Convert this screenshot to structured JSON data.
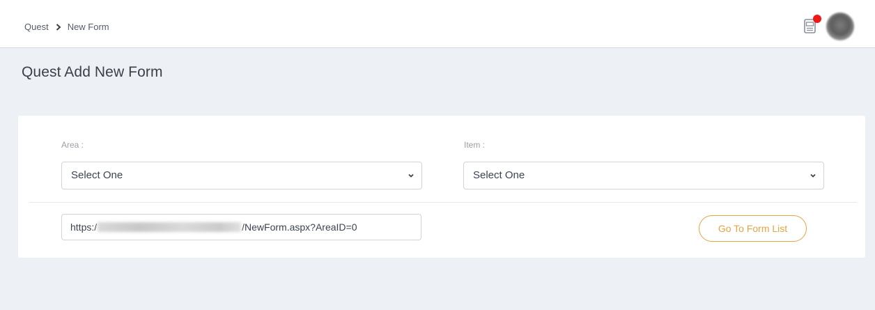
{
  "breadcrumb": {
    "root": "Quest",
    "current": "New Form"
  },
  "header": {
    "notification_icon": "document-bell-icon",
    "has_unread_notification": true
  },
  "page": {
    "title": "Quest Add New Form"
  },
  "form": {
    "area": {
      "label": "Area :",
      "selected": "Select One"
    },
    "item": {
      "label": "Item :",
      "selected": "Select One"
    },
    "url": {
      "prefix": "https:/",
      "suffix": "/NewForm.aspx?AreaID=0"
    },
    "go_to_list_label": "Go To Form List"
  },
  "colors": {
    "accent": "#e3a443",
    "notification_dot": "#ee1a1a",
    "page_bg": "#edf1f5"
  }
}
